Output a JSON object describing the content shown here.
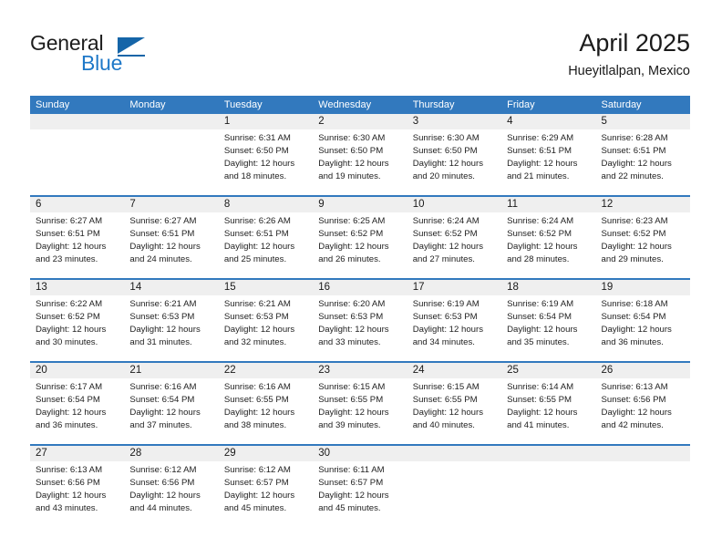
{
  "brand": {
    "word_one": "General",
    "word_two": "Blue",
    "triangle_icon": "blue-triangle-logo-icon"
  },
  "header": {
    "title": "April 2025",
    "subtitle": "Hueyitlalpan, Mexico"
  },
  "colors": {
    "header_blue": "#3279be",
    "date_band_gray": "#efefef",
    "brand_blue": "#1e78c8",
    "text": "#1a1a1a"
  },
  "weekdays": [
    "Sunday",
    "Monday",
    "Tuesday",
    "Wednesday",
    "Thursday",
    "Friday",
    "Saturday"
  ],
  "weeks": [
    [
      {
        "day": "",
        "lines": []
      },
      {
        "day": "",
        "lines": []
      },
      {
        "day": "1",
        "lines": [
          "Sunrise: 6:31 AM",
          "Sunset: 6:50 PM",
          "Daylight: 12 hours",
          "and 18 minutes."
        ]
      },
      {
        "day": "2",
        "lines": [
          "Sunrise: 6:30 AM",
          "Sunset: 6:50 PM",
          "Daylight: 12 hours",
          "and 19 minutes."
        ]
      },
      {
        "day": "3",
        "lines": [
          "Sunrise: 6:30 AM",
          "Sunset: 6:50 PM",
          "Daylight: 12 hours",
          "and 20 minutes."
        ]
      },
      {
        "day": "4",
        "lines": [
          "Sunrise: 6:29 AM",
          "Sunset: 6:51 PM",
          "Daylight: 12 hours",
          "and 21 minutes."
        ]
      },
      {
        "day": "5",
        "lines": [
          "Sunrise: 6:28 AM",
          "Sunset: 6:51 PM",
          "Daylight: 12 hours",
          "and 22 minutes."
        ]
      }
    ],
    [
      {
        "day": "6",
        "lines": [
          "Sunrise: 6:27 AM",
          "Sunset: 6:51 PM",
          "Daylight: 12 hours",
          "and 23 minutes."
        ]
      },
      {
        "day": "7",
        "lines": [
          "Sunrise: 6:27 AM",
          "Sunset: 6:51 PM",
          "Daylight: 12 hours",
          "and 24 minutes."
        ]
      },
      {
        "day": "8",
        "lines": [
          "Sunrise: 6:26 AM",
          "Sunset: 6:51 PM",
          "Daylight: 12 hours",
          "and 25 minutes."
        ]
      },
      {
        "day": "9",
        "lines": [
          "Sunrise: 6:25 AM",
          "Sunset: 6:52 PM",
          "Daylight: 12 hours",
          "and 26 minutes."
        ]
      },
      {
        "day": "10",
        "lines": [
          "Sunrise: 6:24 AM",
          "Sunset: 6:52 PM",
          "Daylight: 12 hours",
          "and 27 minutes."
        ]
      },
      {
        "day": "11",
        "lines": [
          "Sunrise: 6:24 AM",
          "Sunset: 6:52 PM",
          "Daylight: 12 hours",
          "and 28 minutes."
        ]
      },
      {
        "day": "12",
        "lines": [
          "Sunrise: 6:23 AM",
          "Sunset: 6:52 PM",
          "Daylight: 12 hours",
          "and 29 minutes."
        ]
      }
    ],
    [
      {
        "day": "13",
        "lines": [
          "Sunrise: 6:22 AM",
          "Sunset: 6:52 PM",
          "Daylight: 12 hours",
          "and 30 minutes."
        ]
      },
      {
        "day": "14",
        "lines": [
          "Sunrise: 6:21 AM",
          "Sunset: 6:53 PM",
          "Daylight: 12 hours",
          "and 31 minutes."
        ]
      },
      {
        "day": "15",
        "lines": [
          "Sunrise: 6:21 AM",
          "Sunset: 6:53 PM",
          "Daylight: 12 hours",
          "and 32 minutes."
        ]
      },
      {
        "day": "16",
        "lines": [
          "Sunrise: 6:20 AM",
          "Sunset: 6:53 PM",
          "Daylight: 12 hours",
          "and 33 minutes."
        ]
      },
      {
        "day": "17",
        "lines": [
          "Sunrise: 6:19 AM",
          "Sunset: 6:53 PM",
          "Daylight: 12 hours",
          "and 34 minutes."
        ]
      },
      {
        "day": "18",
        "lines": [
          "Sunrise: 6:19 AM",
          "Sunset: 6:54 PM",
          "Daylight: 12 hours",
          "and 35 minutes."
        ]
      },
      {
        "day": "19",
        "lines": [
          "Sunrise: 6:18 AM",
          "Sunset: 6:54 PM",
          "Daylight: 12 hours",
          "and 36 minutes."
        ]
      }
    ],
    [
      {
        "day": "20",
        "lines": [
          "Sunrise: 6:17 AM",
          "Sunset: 6:54 PM",
          "Daylight: 12 hours",
          "and 36 minutes."
        ]
      },
      {
        "day": "21",
        "lines": [
          "Sunrise: 6:16 AM",
          "Sunset: 6:54 PM",
          "Daylight: 12 hours",
          "and 37 minutes."
        ]
      },
      {
        "day": "22",
        "lines": [
          "Sunrise: 6:16 AM",
          "Sunset: 6:55 PM",
          "Daylight: 12 hours",
          "and 38 minutes."
        ]
      },
      {
        "day": "23",
        "lines": [
          "Sunrise: 6:15 AM",
          "Sunset: 6:55 PM",
          "Daylight: 12 hours",
          "and 39 minutes."
        ]
      },
      {
        "day": "24",
        "lines": [
          "Sunrise: 6:15 AM",
          "Sunset: 6:55 PM",
          "Daylight: 12 hours",
          "and 40 minutes."
        ]
      },
      {
        "day": "25",
        "lines": [
          "Sunrise: 6:14 AM",
          "Sunset: 6:55 PM",
          "Daylight: 12 hours",
          "and 41 minutes."
        ]
      },
      {
        "day": "26",
        "lines": [
          "Sunrise: 6:13 AM",
          "Sunset: 6:56 PM",
          "Daylight: 12 hours",
          "and 42 minutes."
        ]
      }
    ],
    [
      {
        "day": "27",
        "lines": [
          "Sunrise: 6:13 AM",
          "Sunset: 6:56 PM",
          "Daylight: 12 hours",
          "and 43 minutes."
        ]
      },
      {
        "day": "28",
        "lines": [
          "Sunrise: 6:12 AM",
          "Sunset: 6:56 PM",
          "Daylight: 12 hours",
          "and 44 minutes."
        ]
      },
      {
        "day": "29",
        "lines": [
          "Sunrise: 6:12 AM",
          "Sunset: 6:57 PM",
          "Daylight: 12 hours",
          "and 45 minutes."
        ]
      },
      {
        "day": "30",
        "lines": [
          "Sunrise: 6:11 AM",
          "Sunset: 6:57 PM",
          "Daylight: 12 hours",
          "and 45 minutes."
        ]
      },
      {
        "day": "",
        "lines": []
      },
      {
        "day": "",
        "lines": []
      },
      {
        "day": "",
        "lines": []
      }
    ]
  ]
}
